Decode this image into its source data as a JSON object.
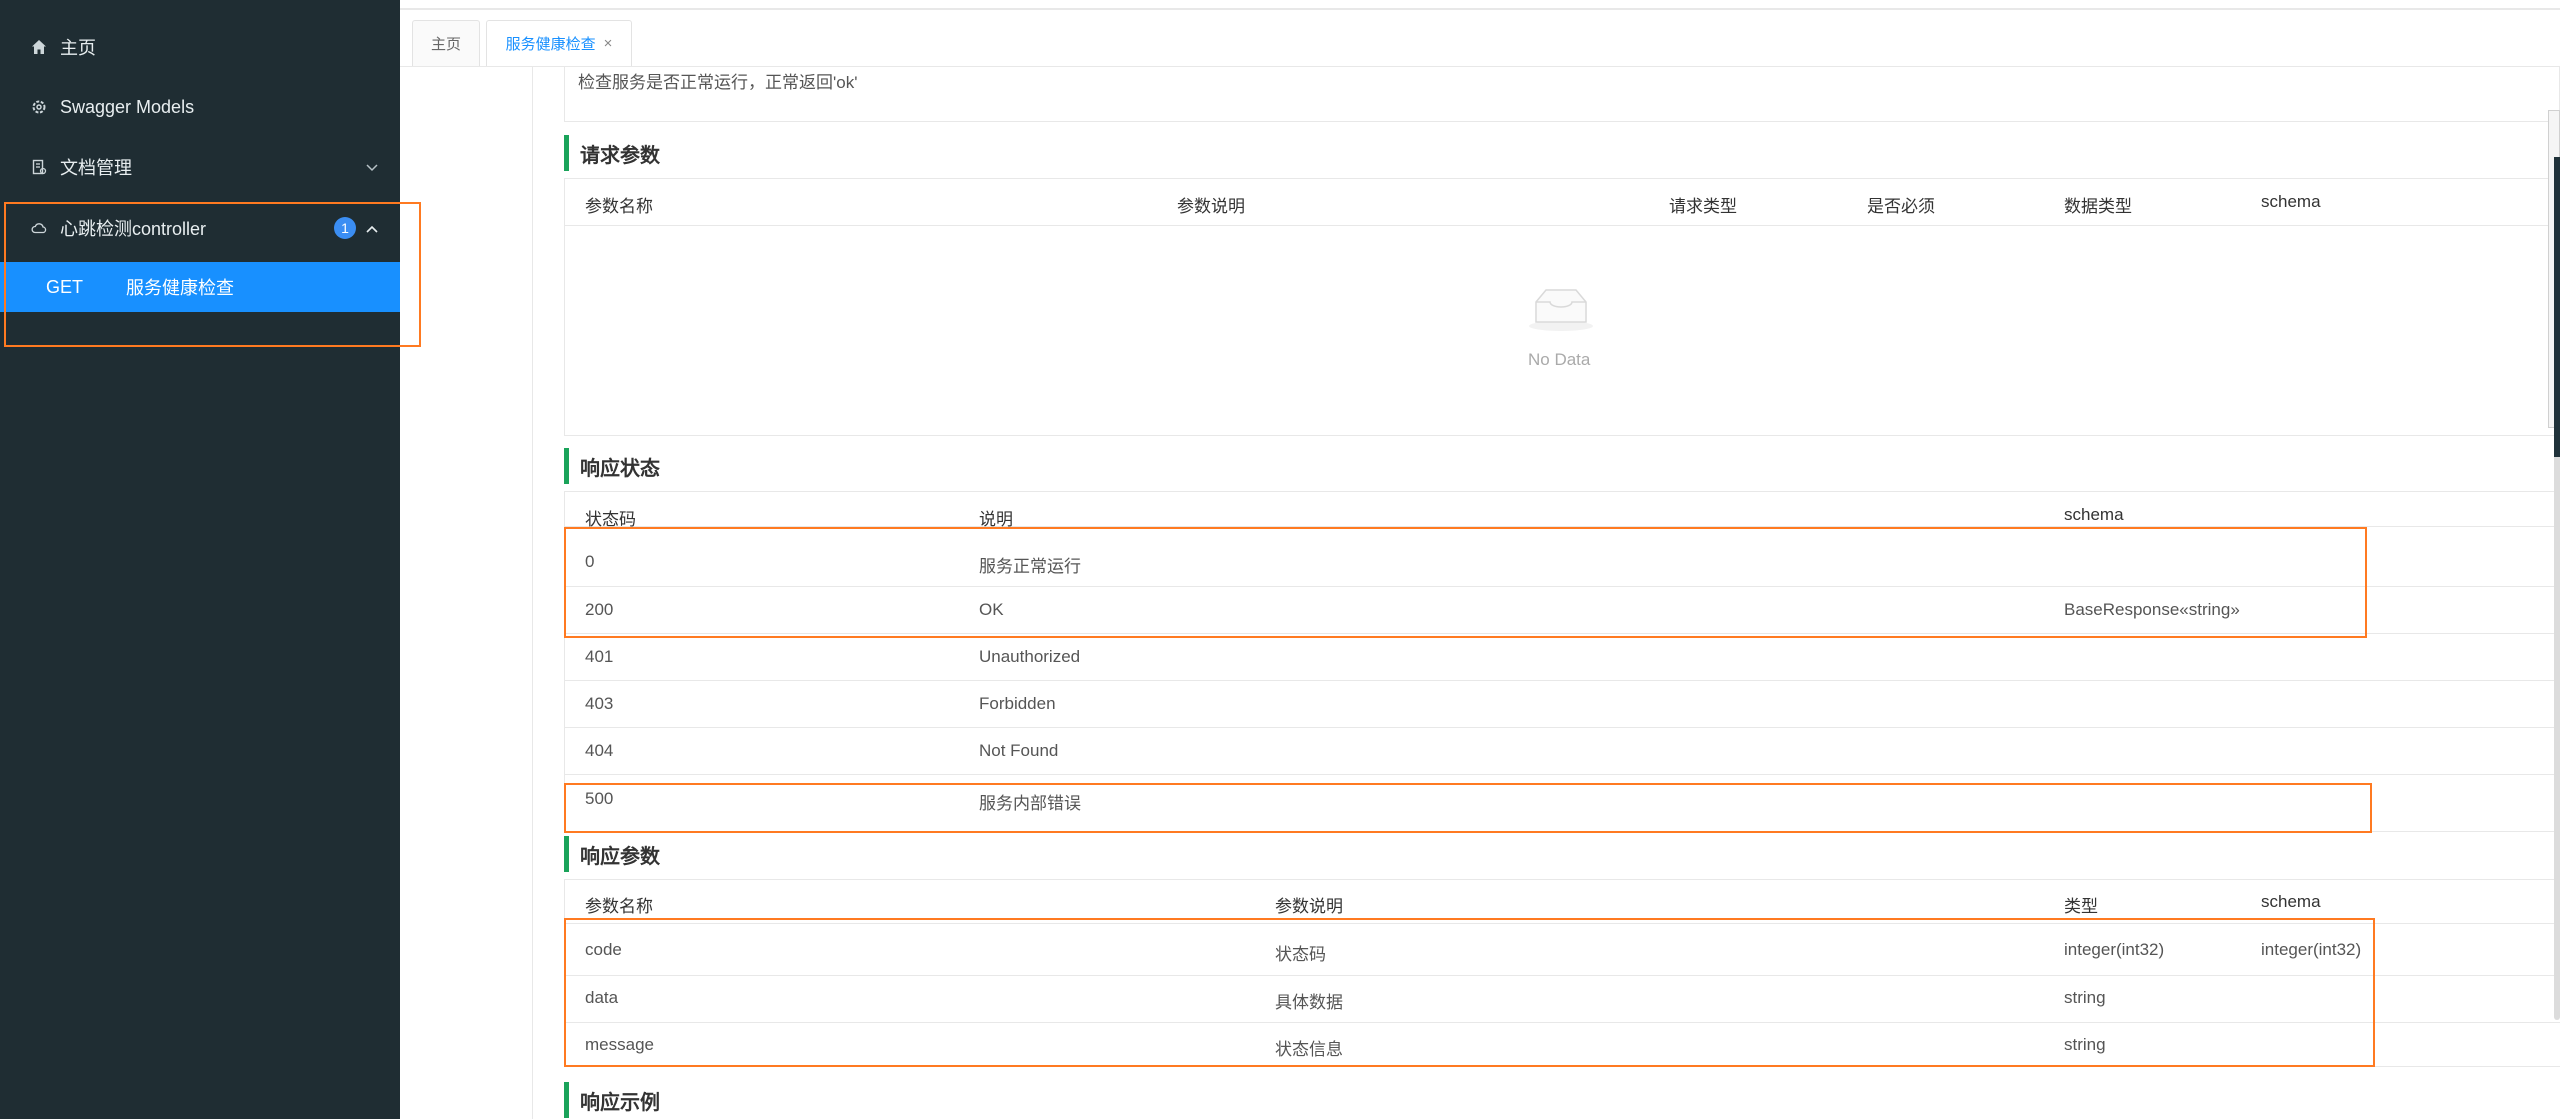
{
  "sidebar": {
    "items": [
      {
        "label": "主页",
        "icon": "home-icon"
      },
      {
        "label": "Swagger Models",
        "icon": "settings-icon"
      },
      {
        "label": "文档管理",
        "icon": "document-icon"
      },
      {
        "label": "心跳检测controller",
        "icon": "cloud-icon",
        "badge": "1"
      }
    ],
    "sub_item": {
      "method": "GET",
      "label": "服务健康检查"
    }
  },
  "tabs": [
    {
      "label": "主页"
    },
    {
      "label": "服务健康检查",
      "close": "×"
    }
  ],
  "description": "检查服务是否正常运行，正常返回'ok'",
  "request_params": {
    "title": "请求参数",
    "headers": [
      "参数名称",
      "参数说明",
      "请求类型",
      "是否必须",
      "数据类型",
      "schema"
    ],
    "empty_text": "No Data"
  },
  "response_status": {
    "title": "响应状态",
    "headers": [
      "状态码",
      "说明",
      "schema"
    ],
    "rows": [
      {
        "code": "0",
        "desc": "服务正常运行",
        "schema": ""
      },
      {
        "code": "200",
        "desc": "OK",
        "schema": "BaseResponse«string»"
      },
      {
        "code": "401",
        "desc": "Unauthorized",
        "schema": ""
      },
      {
        "code": "403",
        "desc": "Forbidden",
        "schema": ""
      },
      {
        "code": "404",
        "desc": "Not Found",
        "schema": ""
      },
      {
        "code": "500",
        "desc": "服务内部错误",
        "schema": ""
      }
    ]
  },
  "response_params": {
    "title": "响应参数",
    "headers": [
      "参数名称",
      "参数说明",
      "类型",
      "schema"
    ],
    "rows": [
      {
        "name": "code",
        "desc": "状态码",
        "type": "integer(int32)",
        "schema": "integer(int32)"
      },
      {
        "name": "data",
        "desc": "具体数据",
        "type": "string",
        "schema": ""
      },
      {
        "name": "message",
        "desc": "状态信息",
        "type": "string",
        "schema": ""
      }
    ]
  },
  "response_example": {
    "title": "响应示例"
  },
  "colors": {
    "sidebar_bg": "#1f2d33",
    "accent": "#1890ff",
    "highlight": "#ff7a21",
    "section_bar": "#1aa35a"
  }
}
